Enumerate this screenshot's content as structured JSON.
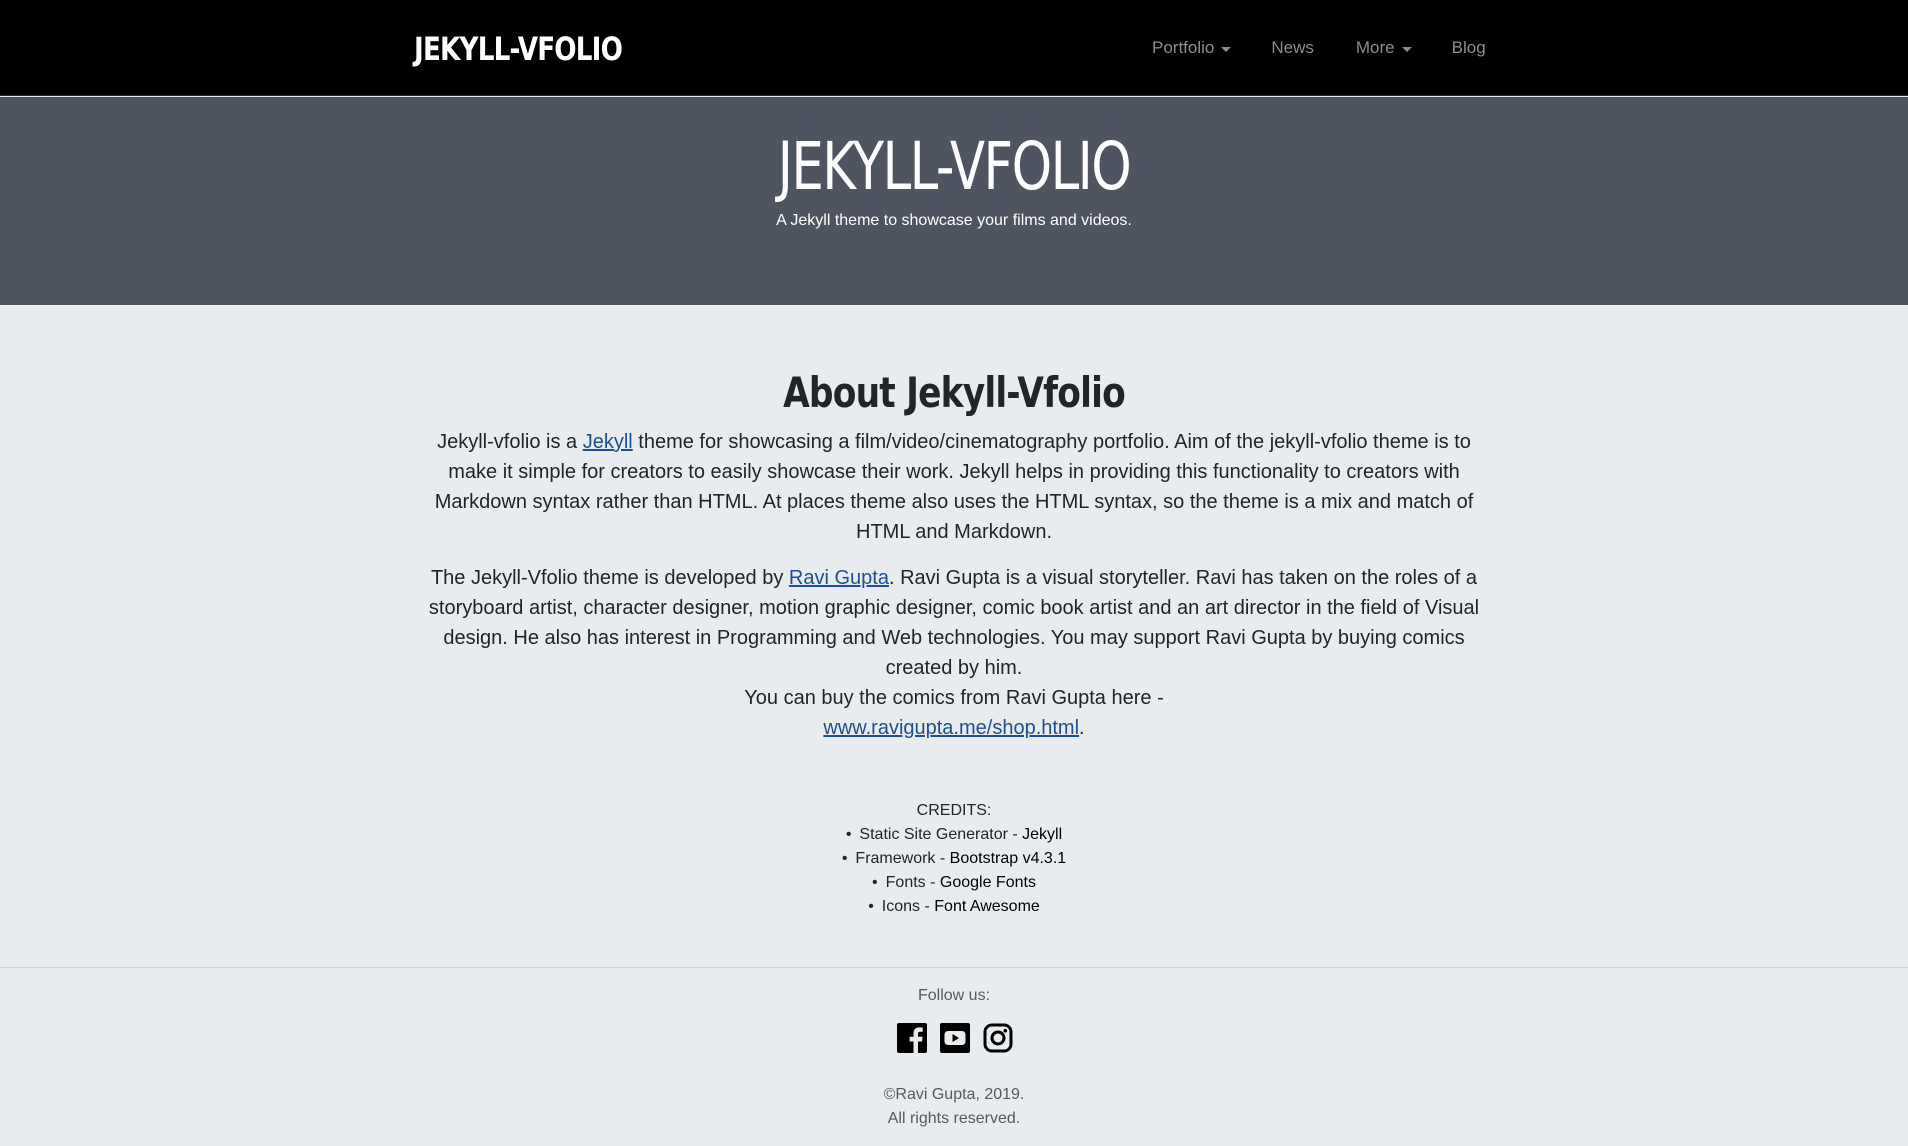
{
  "navbar": {
    "brand": "JEKYLL-VFOLIO",
    "items": [
      {
        "label": "Portfolio",
        "dropdown": true
      },
      {
        "label": "News",
        "dropdown": false
      },
      {
        "label": "More",
        "dropdown": true
      },
      {
        "label": "Blog",
        "dropdown": false
      }
    ]
  },
  "hero": {
    "title": "JEKYLL-VFOLIO",
    "subtitle": "A Jekyll theme to showcase your films and videos."
  },
  "about": {
    "title": "About Jekyll-Vfolio",
    "p1_before": "Jekyll-vfolio is a ",
    "p1_link": "Jekyll",
    "p1_after": " theme for showcasing a film/video/cinematography portfolio. Aim of the jekyll-vfolio theme is to make it simple for creators to easily showcase their work. Jekyll helps in providing this functionality to creators with Markdown syntax rather than HTML. At places theme also uses the HTML syntax, so the theme is a mix and match of HTML and Markdown.",
    "p2_before": "The Jekyll-Vfolio theme is developed by ",
    "p2_link": "Ravi Gupta",
    "p2_after": ". Ravi Gupta is a visual storyteller. Ravi has taken on the roles of a storyboard artist, character designer, motion graphic designer, comic book artist and an art director in the field of Visual design. He also has interest in Programming and Web technologies. You may support Ravi Gupta by buying comics created by him.",
    "p3_line": "You can buy the comics from Ravi Gupta here -",
    "p3_link": "www.ravigupta.me/shop.html",
    "p3_end": "."
  },
  "credits": {
    "heading": "CREDITS:",
    "items": [
      {
        "label": "Static Site Generator",
        "sep": " - ",
        "value": "Jekyll"
      },
      {
        "label": "Framework",
        "sep": " - ",
        "value": "Bootstrap v4.3.1"
      },
      {
        "label": "Fonts",
        "sep": " - ",
        "value": "Google Fonts"
      },
      {
        "label": "Icons",
        "sep": " - ",
        "value": "Font Awesome"
      }
    ]
  },
  "footer": {
    "follow": "Follow us:",
    "social_icons": [
      "facebook-icon",
      "youtube-icon",
      "instagram-icon"
    ],
    "copyright": "©Ravi Gupta, 2019.",
    "rights": "All rights reserved."
  }
}
